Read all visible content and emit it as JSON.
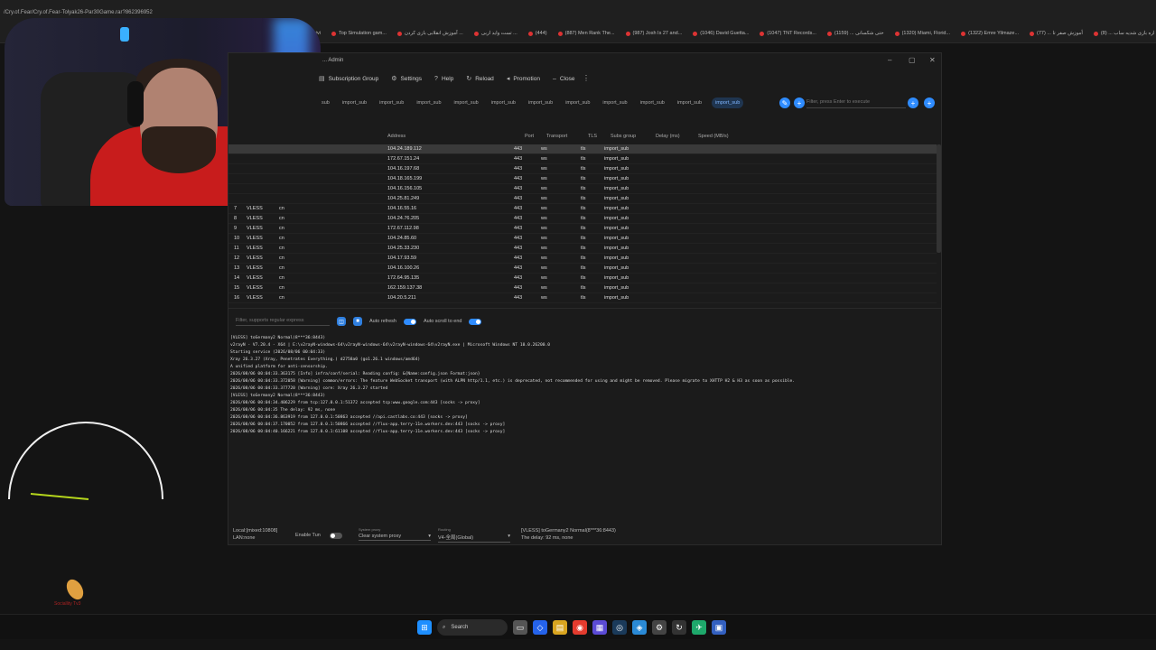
{
  "browser": {
    "url": "/Cry.of.Fear/Cry.of.Fear-Tolyak26-Par30Game.rar?862396952",
    "bookmarks": [
      "Drivi",
      "Top Simulation gam...",
      "آموزش انقلابی بازی کردن ...",
      "تست واید اربی ...",
      "(444)",
      "(887) Men Rank The...",
      "(987) Josh Is 27 and...",
      "(1046) David Guetta...",
      "(1047) TNT Records...",
      "حتی شکسانی ... (1159)",
      "(1320) Miami, Florid...",
      "(1322) Emre Yilmaze...",
      "أموزش صفر تا ... (77)",
      "اره بازی شدیه ساب ... (8)"
    ]
  },
  "app": {
    "title": "... Admin",
    "menu": [
      {
        "icon": "subscription-group-icon",
        "label": "Subscription Group"
      },
      {
        "icon": "gear-icon",
        "label": "Settings"
      },
      {
        "icon": "help-icon",
        "label": "Help"
      },
      {
        "icon": "reload-icon",
        "label": "Reload"
      },
      {
        "icon": "megaphone-icon",
        "label": "Promotion"
      },
      {
        "icon": "minus-icon",
        "label": "Close"
      }
    ],
    "sub_tabs": [
      "sub",
      "import_sub",
      "import_sub",
      "import_sub",
      "import_sub",
      "import_sub",
      "import_sub",
      "import_sub",
      "import_sub",
      "import_sub",
      "import_sub",
      "import_sub"
    ],
    "active_sub_tab": "import_sub",
    "filter_placeholder": "Filter, press Enter to execute",
    "columns": [
      "Address",
      "Port",
      "Transport",
      "TLS",
      "Subs group",
      "Delay (ms)",
      "Speed (MB/s)"
    ],
    "rows": [
      {
        "num": "",
        "type": "",
        "remarks": "",
        "address": "104.24.189.112",
        "port": "443",
        "transport": "ws",
        "tls": "tls",
        "sub": "import_sub"
      },
      {
        "num": "",
        "type": "",
        "remarks": "",
        "address": "172.67.151.24",
        "port": "443",
        "transport": "ws",
        "tls": "tls",
        "sub": "import_sub"
      },
      {
        "num": "",
        "type": "",
        "remarks": "",
        "address": "104.16.197.68",
        "port": "443",
        "transport": "ws",
        "tls": "tls",
        "sub": "import_sub"
      },
      {
        "num": "",
        "type": "",
        "remarks": "",
        "address": "104.18.165.199",
        "port": "443",
        "transport": "ws",
        "tls": "tls",
        "sub": "import_sub"
      },
      {
        "num": "",
        "type": "",
        "remarks": "",
        "address": "104.16.156.105",
        "port": "443",
        "transport": "ws",
        "tls": "tls",
        "sub": "import_sub"
      },
      {
        "num": "",
        "type": "",
        "remarks": "",
        "address": "104.25.81.249",
        "port": "443",
        "transport": "ws",
        "tls": "tls",
        "sub": "import_sub"
      },
      {
        "num": "7",
        "type": "VLESS",
        "remarks": "cn",
        "address": "104.16.55.16",
        "port": "443",
        "transport": "ws",
        "tls": "tls",
        "sub": "import_sub"
      },
      {
        "num": "8",
        "type": "VLESS",
        "remarks": "cn",
        "address": "104.24.76.205",
        "port": "443",
        "transport": "ws",
        "tls": "tls",
        "sub": "import_sub"
      },
      {
        "num": "9",
        "type": "VLESS",
        "remarks": "cn",
        "address": "172.67.112.98",
        "port": "443",
        "transport": "ws",
        "tls": "tls",
        "sub": "import_sub"
      },
      {
        "num": "10",
        "type": "VLESS",
        "remarks": "cn",
        "address": "104.24.85.60",
        "port": "443",
        "transport": "ws",
        "tls": "tls",
        "sub": "import_sub"
      },
      {
        "num": "11",
        "type": "VLESS",
        "remarks": "cn",
        "address": "104.25.33.230",
        "port": "443",
        "transport": "ws",
        "tls": "tls",
        "sub": "import_sub"
      },
      {
        "num": "12",
        "type": "VLESS",
        "remarks": "cn",
        "address": "104.17.93.59",
        "port": "443",
        "transport": "ws",
        "tls": "tls",
        "sub": "import_sub"
      },
      {
        "num": "13",
        "type": "VLESS",
        "remarks": "cn",
        "address": "104.16.100.26",
        "port": "443",
        "transport": "ws",
        "tls": "tls",
        "sub": "import_sub"
      },
      {
        "num": "14",
        "type": "VLESS",
        "remarks": "cn",
        "address": "172.64.95.135",
        "port": "443",
        "transport": "ws",
        "tls": "tls",
        "sub": "import_sub"
      },
      {
        "num": "15",
        "type": "VLESS",
        "remarks": "cn",
        "address": "162.159.137.38",
        "port": "443",
        "transport": "ws",
        "tls": "tls",
        "sub": "import_sub"
      },
      {
        "num": "16",
        "type": "VLESS",
        "remarks": "cn",
        "address": "104.20.5.211",
        "port": "443",
        "transport": "ws",
        "tls": "tls",
        "sub": "import_sub"
      }
    ],
    "log_filter_placeholder": "Filter, supports regular express",
    "auto_refresh_label": "Auto refresh",
    "auto_scroll_label": "Auto scroll to end",
    "log_lines": [
      "[VLESS] toGermany2 Normal(8***36:8443)",
      "v2rayN - V7.20.4 - X64 | E:\\v2rayN-windows-64\\v2rayN-windows-64\\v2rayN-windows-64\\v2rayN.exe | Microsoft Windows NT 10.0.26200.0",
      "Starting service (2026/08/06 00:04:33)",
      "Xray 26.3.27 (Xray, Penetrates Everything.) d2758a0 (go1.26.1 windows/amd64)",
      "A unified platform for anti-censorship.",
      "2026/08/06 00:04:33.363175 [Info] infra/conf/serial: Reading config: &{Name:config.json Format:json}",
      "2026/08/06 00:04:33.372058 [Warning] common/errors: The feature WebSocket transport (with ALPN http/1.1, etc.) is deprecated, not recommended for using and might be removed. Please migrate to XHTTP H2 & H3 as soon as possible.",
      "2026/08/06 00:04:33.377720 [Warning] core: Xray 26.3.27 started",
      "[VLESS] toGermany2 Normal(8***36:8443)",
      "2026/08/06 00:04:34.406229 from tcp:127.0.0.1:51372 accepted tcp:www.google.com:443 [socks -> proxy]",
      "2026/08/06 00:04:35 The delay: 92 ms, none",
      "2026/08/06 00:04:36.863919 from 127.0.0.1:50863 accepted //api.castlabs.co:443 [socks -> proxy]",
      "2026/08/06 00:04:37.170052 from 127.0.0.1:50866 accepted //flux-app.terry-11e.workers.dev:443 [socks -> proxy]",
      "2026/08/06 00:04:40.166221 from 127.0.0.1:61108 accepted //flux-app.terry-11e.workers.dev:443 [socks -> proxy]"
    ],
    "status": {
      "local": "Local:[mixed:10808]",
      "lan": "LAN:none",
      "enable_tun_label": "Enable Tun",
      "system_proxy_caption": "System proxy",
      "system_proxy_value": "Clear system proxy",
      "routing_caption": "Routing",
      "routing_value": "V4-全局(Global)",
      "active_server": "[VLESS] toGermany2 Normal(8***36:8443)",
      "delay": "The delay: 92 ms, none"
    }
  },
  "overlay_logo_text": "Sociallity Tv3",
  "taskbar": {
    "search_label": "Search"
  }
}
